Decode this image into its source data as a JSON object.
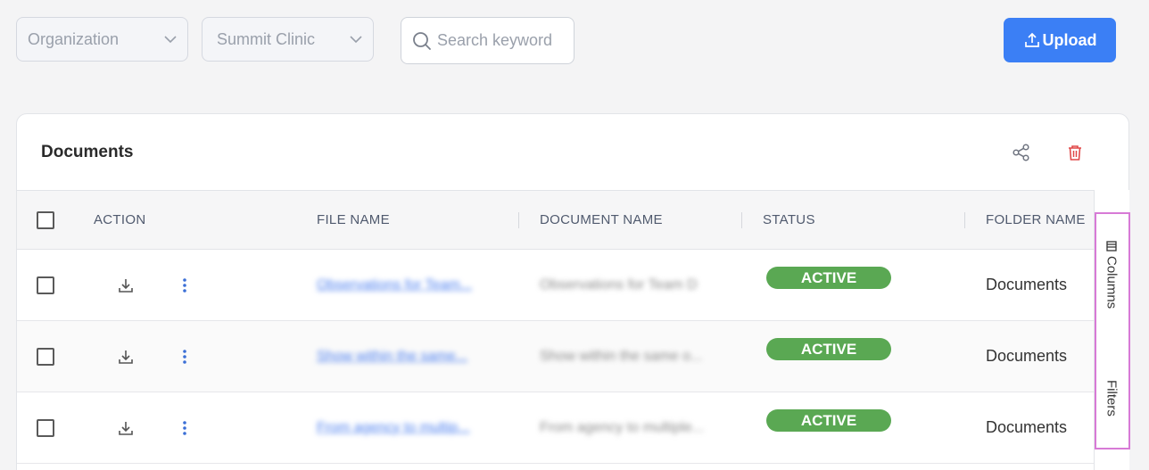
{
  "filters": {
    "organization_label": "Organization",
    "clinic_label": "Summit Clinic",
    "search_placeholder": "Search keyword"
  },
  "upload_label": "Upload",
  "panel": {
    "title": "Documents"
  },
  "table": {
    "headers": {
      "action": "ACTION",
      "file_name": "FILE NAME",
      "document_name": "DOCUMENT NAME",
      "status": "STATUS",
      "folder_name": "FOLDER NAME"
    },
    "rows": [
      {
        "file_name": "Observations for Team...",
        "document_name": "Observations for Team D",
        "status": "ACTIVE",
        "folder": "Documents"
      },
      {
        "file_name": "Show within the same...",
        "document_name": "Show within the same o...",
        "status": "ACTIVE",
        "folder": "Documents"
      },
      {
        "file_name": "From agency to multip...",
        "document_name": "From agency to multiple...",
        "status": "ACTIVE",
        "folder": "Documents"
      }
    ]
  },
  "side_panel": {
    "columns_label": "Columns",
    "filters_label": "Filters"
  },
  "colors": {
    "primary": "#3b7ff5",
    "active_badge": "#5aa853",
    "delete_icon": "#e04848",
    "link": "#4c7fef",
    "highlight_border": "#d77ad6"
  }
}
